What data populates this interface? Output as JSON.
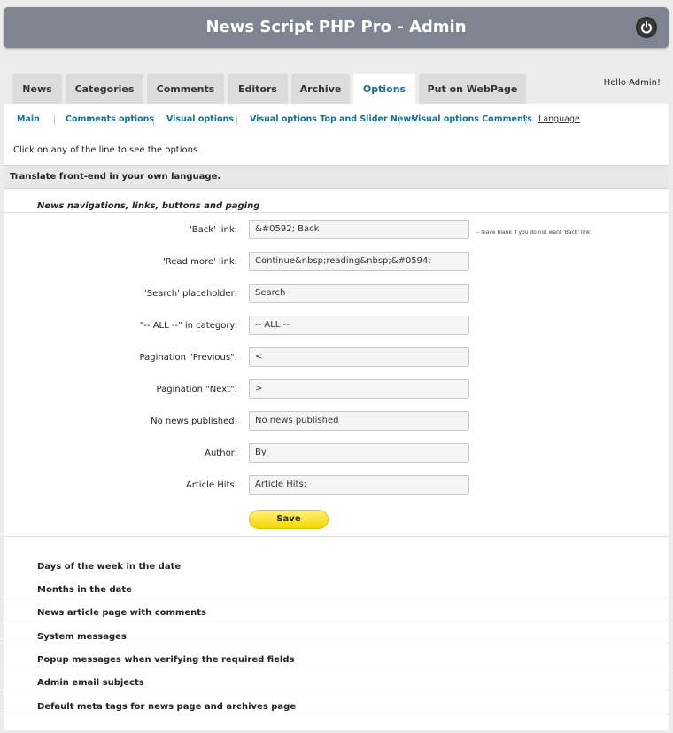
{
  "header": {
    "title": "News Script PHP Pro - Admin",
    "logout_icon": "power-icon"
  },
  "greeting": "Hello Admin!",
  "tabs": [
    {
      "label": "News"
    },
    {
      "label": "Categories"
    },
    {
      "label": "Comments"
    },
    {
      "label": "Editors"
    },
    {
      "label": "Archive"
    },
    {
      "label": "Options",
      "active": true
    },
    {
      "label": "Put on WebPage"
    }
  ],
  "subnav": [
    {
      "label": "Main"
    },
    {
      "label": "Comments options"
    },
    {
      "label": "Visual options"
    },
    {
      "label": "Visual options Top and Slider News"
    },
    {
      "label": "Visual options Comments"
    },
    {
      "label": "Language",
      "current": true
    }
  ],
  "hint": "Click on any of the line to see the options.",
  "section_title": "Translate front-end in your own language.",
  "subsection_title": "News navigations, links, buttons and paging",
  "fields": [
    {
      "label": "'Back' link:",
      "value": "&#0592; Back"
    },
    {
      "label": "'Read more' link:",
      "value": "Continue&nbsp;reading&nbsp;&#0594;"
    },
    {
      "label": "'Search' placeholder:",
      "value": "Search"
    },
    {
      "label": "\"-- ALL --\" in category:",
      "value": "-- ALL --"
    },
    {
      "label": "Pagination \"Previous\":",
      "value": "<"
    },
    {
      "label": "Pagination \"Next\":",
      "value": ">"
    },
    {
      "label": "No news published:",
      "value": "No news published"
    },
    {
      "label": "Author:",
      "value": "By"
    },
    {
      "label": "Article Hits:",
      "value": "Article Hits:"
    }
  ],
  "back_note": "-- leave blank if you do not want 'Back' link",
  "save_label": "Save",
  "collapsed_sections": [
    {
      "label": "Days of the week in the date"
    },
    {
      "label": "Months in the date"
    },
    {
      "label": "News article page with comments"
    },
    {
      "label": "System messages"
    },
    {
      "label": "Popup messages when verifying the required fields"
    },
    {
      "label": "Admin email subjects"
    },
    {
      "label": "Default meta tags for news page and archives page"
    }
  ]
}
